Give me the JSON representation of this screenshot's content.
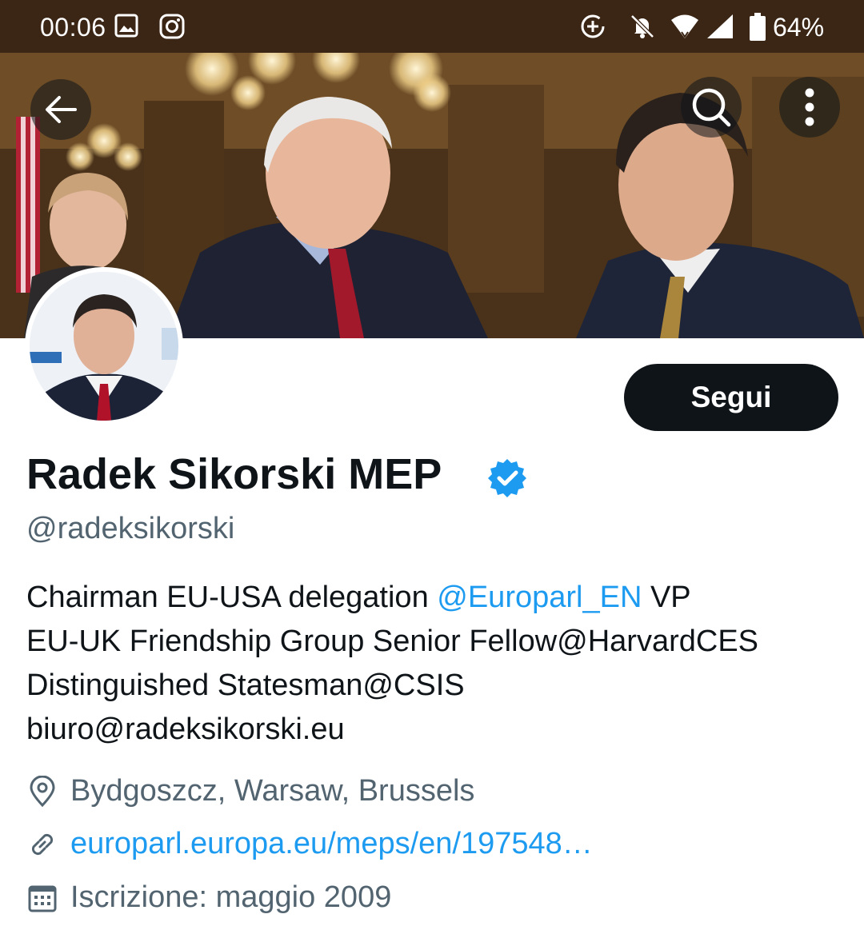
{
  "status_bar": {
    "time": "00:06",
    "battery": "64%",
    "icons": [
      "gallery-icon",
      "instagram-icon",
      "data-saver-icon",
      "bell-off-icon",
      "wifi-icon",
      "signal-icon",
      "battery-icon"
    ]
  },
  "header": {
    "back_icon": "arrow-left-icon",
    "search_icon": "search-icon",
    "more_icon": "more-vertical-icon"
  },
  "profile": {
    "follow_label": "Segui",
    "display_name": "Radek Sikorski MEP",
    "verified": true,
    "handle": "@radeksikorski",
    "bio": {
      "line1_text": "Chairman EU-USA delegation ",
      "line1_mention": "@Europarl_EN",
      "line1_tail": " VP",
      "line2": "EU-UK Friendship Group Senior Fellow@HarvardCES",
      "line3": "Distinguished Statesman@CSIS",
      "line4": "biuro@radeksikorski.eu"
    },
    "location": "Bydgoszcz, Warsaw, Brussels",
    "website": "europarl.europa.eu/meps/en/197548…",
    "joined": "Iscrizione: maggio 2009"
  },
  "colors": {
    "accent": "#1d9bf0",
    "text": "#0f1419",
    "secondary": "#536471",
    "status_bar": "#3b2514"
  }
}
